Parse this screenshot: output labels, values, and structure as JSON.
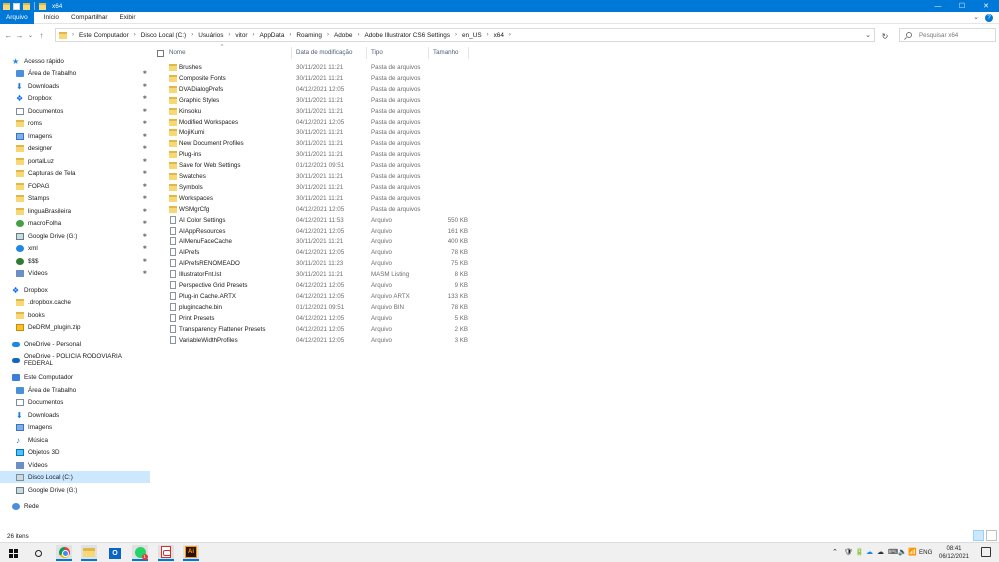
{
  "window": {
    "title": "x64",
    "controls": {
      "minimize": "—",
      "maximize": "☐",
      "close": "✕"
    }
  },
  "ribbon": {
    "tabs": [
      "Arquivo",
      "Início",
      "Compartilhar",
      "Exibir"
    ],
    "help": "?",
    "expand": "⌄"
  },
  "address": {
    "crumbs": [
      "Este Computador",
      "Disco Local (C:)",
      "Usuários",
      "vitor",
      "AppData",
      "Roaming",
      "Adobe",
      "Adobe Illustrator CS6 Settings",
      "en_US",
      "x64"
    ]
  },
  "search": {
    "placeholder": "Pesquisar x64"
  },
  "sidebar": {
    "items": [
      {
        "label": "Acesso rápido",
        "icon": "star-icon",
        "pinned": false
      },
      {
        "label": "Área de Trabalho",
        "icon": "desktop-icon",
        "pinned": true
      },
      {
        "label": "Downloads",
        "icon": "download-icon",
        "pinned": true
      },
      {
        "label": "Dropbox",
        "icon": "dropbox-icon",
        "pinned": true
      },
      {
        "label": "Documentos",
        "icon": "document-icon",
        "pinned": true
      },
      {
        "label": "roms",
        "icon": "folder-icon",
        "pinned": true
      },
      {
        "label": "Imagens",
        "icon": "pictures-icon",
        "pinned": true
      },
      {
        "label": "designer",
        "icon": "folder-icon",
        "pinned": true
      },
      {
        "label": "portalLuz",
        "icon": "folder-icon",
        "pinned": true
      },
      {
        "label": "Capturas de Tela",
        "icon": "folder-icon",
        "pinned": true
      },
      {
        "label": "FOPAG",
        "icon": "folder-icon",
        "pinned": true
      },
      {
        "label": "Stamps",
        "icon": "folder-icon",
        "pinned": true
      },
      {
        "label": "linguaBrasileira",
        "icon": "folder-icon",
        "pinned": true
      },
      {
        "label": "macroFolha",
        "icon": "app-icon",
        "pinned": true
      },
      {
        "label": "Google Drive (G:)",
        "icon": "drive-icon",
        "pinned": true
      },
      {
        "label": "xml",
        "icon": "xml-icon",
        "pinned": true
      },
      {
        "label": "$$$",
        "icon": "money-icon",
        "pinned": true
      },
      {
        "label": "Vídeos",
        "icon": "videos-icon",
        "pinned": true
      },
      {
        "label": "Dropbox",
        "icon": "dropbox-icon",
        "pinned": false
      },
      {
        "label": ".dropbox.cache",
        "icon": "folder-icon",
        "pinned": false
      },
      {
        "label": "books",
        "icon": "folder-icon",
        "pinned": false
      },
      {
        "label": "DeDRM_plugin.zip",
        "icon": "zip-icon",
        "pinned": false
      },
      {
        "label": "OneDrive - Personal",
        "icon": "onedrive-icon",
        "pinned": false
      },
      {
        "label": "OneDrive - POLICIA RODOVIARIA FEDERAL",
        "icon": "onedrive-business-icon",
        "pinned": false
      },
      {
        "label": "Este Computador",
        "icon": "computer-icon",
        "pinned": false
      },
      {
        "label": "Área de Trabalho",
        "icon": "desktop-icon",
        "pinned": false
      },
      {
        "label": "Documentos",
        "icon": "document-icon",
        "pinned": false
      },
      {
        "label": "Downloads",
        "icon": "download-icon",
        "pinned": false
      },
      {
        "label": "Imagens",
        "icon": "pictures-icon",
        "pinned": false
      },
      {
        "label": "Música",
        "icon": "music-icon",
        "pinned": false
      },
      {
        "label": "Objetos 3D",
        "icon": "objects-3d-icon",
        "pinned": false
      },
      {
        "label": "Vídeos",
        "icon": "videos-icon",
        "pinned": false
      },
      {
        "label": "Disco Local (C:)",
        "icon": "disk-icon",
        "pinned": false,
        "selected": true
      },
      {
        "label": "Google Drive (G:)",
        "icon": "drive-icon",
        "pinned": false
      },
      {
        "label": "Rede",
        "icon": "network-icon",
        "pinned": false
      }
    ]
  },
  "columns": {
    "name": "Nome",
    "date": "Data de modificação",
    "type": "Tipo",
    "size": "Tamanho"
  },
  "files": [
    {
      "name": "Brushes",
      "date": "30/11/2021 11:21",
      "type": "Pasta de arquivos",
      "size": "",
      "kind": "folder"
    },
    {
      "name": "Composite Fonts",
      "date": "30/11/2021 11:21",
      "type": "Pasta de arquivos",
      "size": "",
      "kind": "folder"
    },
    {
      "name": "DVADialogPrefs",
      "date": "04/12/2021 12:05",
      "type": "Pasta de arquivos",
      "size": "",
      "kind": "folder"
    },
    {
      "name": "Graphic Styles",
      "date": "30/11/2021 11:21",
      "type": "Pasta de arquivos",
      "size": "",
      "kind": "folder"
    },
    {
      "name": "Kinsoku",
      "date": "30/11/2021 11:21",
      "type": "Pasta de arquivos",
      "size": "",
      "kind": "folder"
    },
    {
      "name": "Modified Workspaces",
      "date": "04/12/2021 12:05",
      "type": "Pasta de arquivos",
      "size": "",
      "kind": "folder"
    },
    {
      "name": "MojiKumi",
      "date": "30/11/2021 11:21",
      "type": "Pasta de arquivos",
      "size": "",
      "kind": "folder"
    },
    {
      "name": "New Document Profiles",
      "date": "30/11/2021 11:21",
      "type": "Pasta de arquivos",
      "size": "",
      "kind": "folder"
    },
    {
      "name": "Plug-ins",
      "date": "30/11/2021 11:21",
      "type": "Pasta de arquivos",
      "size": "",
      "kind": "folder"
    },
    {
      "name": "Save for Web Settings",
      "date": "01/12/2021 09:51",
      "type": "Pasta de arquivos",
      "size": "",
      "kind": "folder"
    },
    {
      "name": "Swatches",
      "date": "30/11/2021 11:21",
      "type": "Pasta de arquivos",
      "size": "",
      "kind": "folder"
    },
    {
      "name": "Symbols",
      "date": "30/11/2021 11:21",
      "type": "Pasta de arquivos",
      "size": "",
      "kind": "folder"
    },
    {
      "name": "Workspaces",
      "date": "30/11/2021 11:21",
      "type": "Pasta de arquivos",
      "size": "",
      "kind": "folder"
    },
    {
      "name": "WSMgrCfg",
      "date": "04/12/2021 12:05",
      "type": "Pasta de arquivos",
      "size": "",
      "kind": "folder"
    },
    {
      "name": "AI Color Settings",
      "date": "04/12/2021 11:53",
      "type": "Arquivo",
      "size": "550 KB",
      "kind": "file"
    },
    {
      "name": "AIAppResources",
      "date": "04/12/2021 12:05",
      "type": "Arquivo",
      "size": "161 KB",
      "kind": "file"
    },
    {
      "name": "AIMenuFaceCache",
      "date": "30/11/2021 11:21",
      "type": "Arquivo",
      "size": "400 KB",
      "kind": "file"
    },
    {
      "name": "AIPrefs",
      "date": "04/12/2021 12:05",
      "type": "Arquivo",
      "size": "78 KB",
      "kind": "file"
    },
    {
      "name": "AIPrefsRENOMEADO",
      "date": "30/11/2021 11:23",
      "type": "Arquivo",
      "size": "75 KB",
      "kind": "file"
    },
    {
      "name": "IllustratorFnt.lst",
      "date": "30/11/2021 11:21",
      "type": "MASM Listing",
      "size": "8 KB",
      "kind": "file"
    },
    {
      "name": "Perspective Grid Presets",
      "date": "04/12/2021 12:05",
      "type": "Arquivo",
      "size": "9 KB",
      "kind": "file"
    },
    {
      "name": "Plug-in Cache.ARTX",
      "date": "04/12/2021 12:05",
      "type": "Arquivo ARTX",
      "size": "133 KB",
      "kind": "file"
    },
    {
      "name": "plugincache.bin",
      "date": "01/12/2021 09:51",
      "type": "Arquivo BIN",
      "size": "78 KB",
      "kind": "file"
    },
    {
      "name": "Print Presets",
      "date": "04/12/2021 12:05",
      "type": "Arquivo",
      "size": "5 KB",
      "kind": "file"
    },
    {
      "name": "Transparency Flattener Presets",
      "date": "04/12/2021 12:05",
      "type": "Arquivo",
      "size": "2 KB",
      "kind": "file"
    },
    {
      "name": "VariableWidthProfiles",
      "date": "04/12/2021 12:05",
      "type": "Arquivo",
      "size": "3 KB",
      "kind": "file"
    }
  ],
  "status": {
    "count": "26 itens"
  },
  "taskbar": {
    "outlook_letter": "O",
    "whatsapp_badge": "1",
    "ai_label": "Ai",
    "tray": {
      "chevron": "⌃",
      "icons": [
        "🛡",
        "🔋",
        "☁",
        "☁",
        "⌨",
        "🔈",
        "📶"
      ],
      "lang": "ENG",
      "time": "08:41",
      "date": "06/12/2021"
    }
  }
}
